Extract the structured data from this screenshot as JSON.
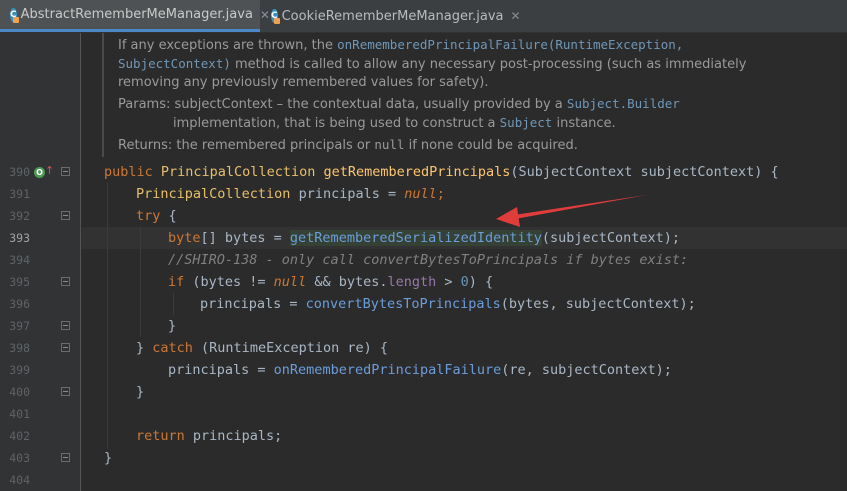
{
  "tabs": [
    {
      "label": "AbstractRememberMeManager.java",
      "icon": "c-class-icon",
      "active": true
    },
    {
      "label": "CookieRememberMeManager.java",
      "icon": "c-class-icon",
      "active": false
    }
  ],
  "doc": {
    "line1_a": "If any exceptions are thrown, the ",
    "line1_code": "onRememberedPrincipalFailure(RuntimeException,",
    "line2_code": "SubjectContext)",
    "line2_b": " method is called to allow any necessary post-processing (such as immediately",
    "line3": "removing any previously remembered values for safety).",
    "params_label": "Params:",
    "params_a": " subjectContext – the contextual data, usually provided by a ",
    "params_code": "Subject.Builder",
    "params_b": "implementation, that is being used to construct a ",
    "params_code2": "Subject",
    "params_c": " instance.",
    "returns_label": "Returns:",
    "returns_a": " the remembered principals or ",
    "returns_code": "null",
    "returns_b": " if none could be acquired."
  },
  "lines": [
    "390",
    "391",
    "392",
    "393",
    "394",
    "395",
    "396",
    "397",
    "398",
    "399",
    "400",
    "401",
    "402",
    "403",
    "404"
  ],
  "code": {
    "l390_kw": "public ",
    "l390_type": "PrincipalCollection ",
    "l390_fn": "getRememberedPrincipals",
    "l390_rest": "(SubjectContext subjectContext) {",
    "l391_type": "PrincipalCollection ",
    "l391_mid": "principals = ",
    "l391_null": "null",
    "l391_end": ";",
    "l392_kw": "try ",
    "l392_end": "{",
    "l393_kw": "byte",
    "l393_mid": "[] bytes = ",
    "l393_call": "getRememberedSerializedIdentity",
    "l393_end": "(subjectContext);",
    "l394_cmt": "//SHIRO-138 - only call convertBytesToPrincipals if bytes exist:",
    "l395_kw": "if ",
    "l395_a": "(bytes != ",
    "l395_null": "null",
    "l395_b": " && bytes.",
    "l395_fld": "length",
    "l395_c": " > ",
    "l395_num": "0",
    "l395_d": ") {",
    "l396_a": "principals = ",
    "l396_call": "convertBytesToPrincipals",
    "l396_b": "(bytes, subjectContext);",
    "l397": "}",
    "l398_a": "} ",
    "l398_kw": "catch ",
    "l398_b": "(RuntimeException re) {",
    "l399_a": "principals = ",
    "l399_call": "onRememberedPrincipalFailure",
    "l399_b": "(re, subjectContext);",
    "l400": "}",
    "l402_kw": "return ",
    "l402_b": "principals;",
    "l403": "}"
  },
  "gutter_marker": {
    "icon": "override-method-icon",
    "label": "O"
  },
  "colors": {
    "accent": "#4a88c7",
    "arrow": "#e03c3c"
  }
}
